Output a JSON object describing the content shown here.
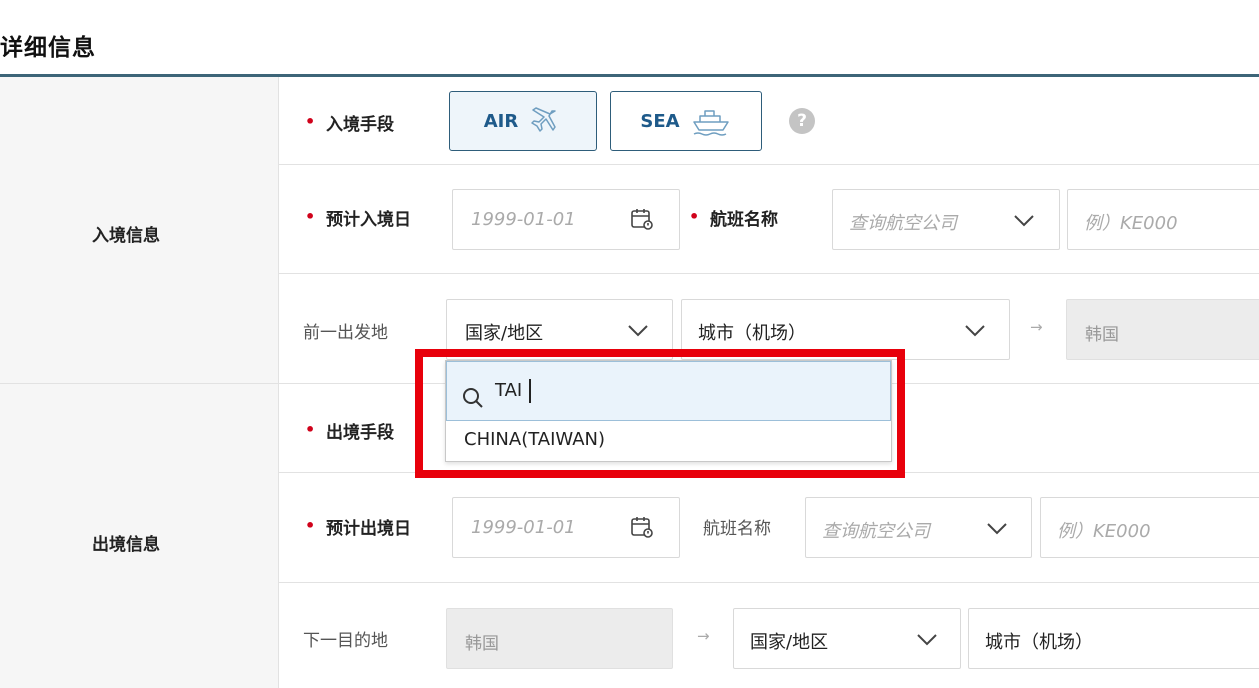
{
  "section_title": "详细信息",
  "entry": {
    "group_label": "入境信息",
    "mode_label": "入境手段",
    "air_label": "AIR",
    "sea_label": "SEA",
    "help_symbol": "?",
    "date_label": "预计入境日",
    "date_placeholder": "1999-01-01",
    "flight_label": "航班名称",
    "airline_placeholder": "查询航空公司",
    "flight_no_placeholder": "例）KE000",
    "prev_departure_label": "前一出发地",
    "country_select": "国家/地区",
    "city_select": "城市（机场）",
    "destination_value": "韩国"
  },
  "country_dropdown": {
    "search_value": "TAI",
    "options": [
      "CHINA(TAIWAN)"
    ]
  },
  "exit": {
    "group_label": "出境信息",
    "mode_label": "出境手段",
    "date_label": "预计出境日",
    "date_placeholder": "1999-01-01",
    "flight_label": "航班名称",
    "airline_placeholder": "查询航空公司",
    "flight_no_placeholder": "例）KE000",
    "next_destination_label": "下一目的地",
    "origin_value": "韩国",
    "country_select": "国家/地区",
    "city_select": "城市（机场）"
  },
  "colors": {
    "accent": "#1e5a8a",
    "required": "#d0021b",
    "highlight": "#e8000b",
    "rule": "#3d6578"
  },
  "icons": {
    "air": "airplane-icon",
    "sea": "ship-icon",
    "calendar": "calendar-icon",
    "search": "search-icon",
    "chevron": "chevron-down-icon",
    "arrow": "arrow-right-icon"
  }
}
